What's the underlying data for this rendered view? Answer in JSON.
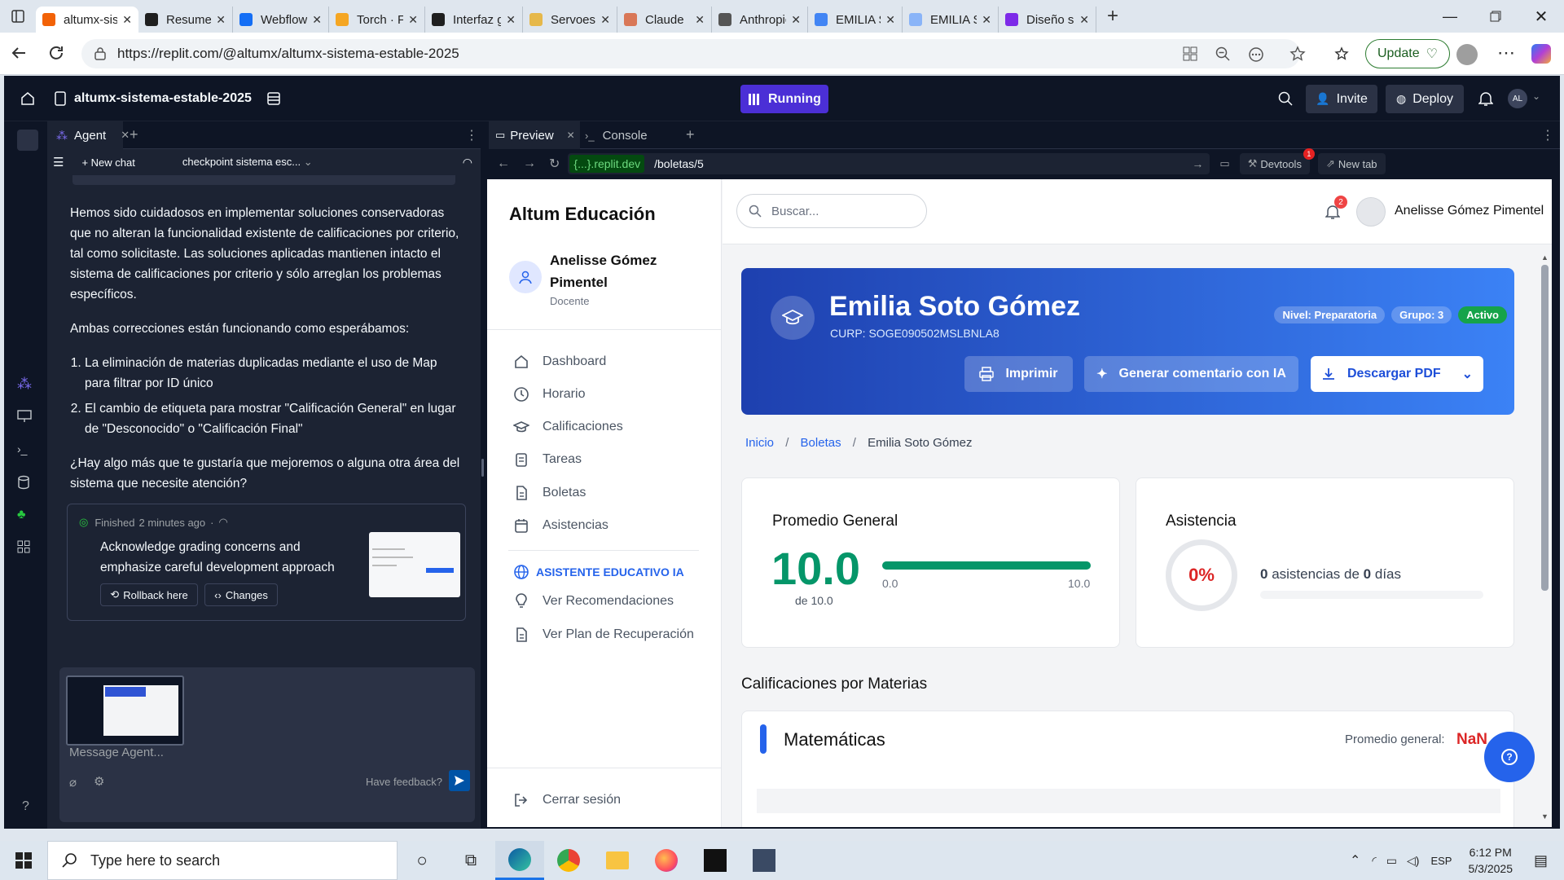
{
  "browser": {
    "tabs": [
      {
        "label": "altumx-sis",
        "color": "#f26207",
        "active": true
      },
      {
        "label": "Resumen",
        "color": "#1f1f1f"
      },
      {
        "label": "Webflow -",
        "color": "#146ef5"
      },
      {
        "label": "Torch · Fea",
        "color": "#f5a623"
      },
      {
        "label": "Interfaz ge",
        "color": "#1f1f1f"
      },
      {
        "label": "Servoesco",
        "color": "#e6b84a"
      },
      {
        "label": "Claude",
        "color": "#d97757"
      },
      {
        "label": "Anthropic",
        "color": "#555555"
      },
      {
        "label": "EMILIA SC",
        "color": "#4285f4"
      },
      {
        "label": "EMILIA SC",
        "color": "#8ab4f8"
      },
      {
        "label": "Diseño sin",
        "color": "#7d2ae8"
      }
    ],
    "url": "https://replit.com/@altumx/altumx-sistema-estable-2025",
    "update_label": "Update"
  },
  "replit": {
    "project_name": "altumx-sistema-estable-2025",
    "status": "Running",
    "invite_label": "Invite",
    "deploy_label": "Deploy",
    "avatar_initials": "AL",
    "agent_tab": "Agent",
    "new_chat": "New chat",
    "checkpoint": "checkpoint sistema esc...",
    "paragraph1": "Hemos sido cuidadosos en implementar soluciones conservadoras que no alteran la funcionalidad existente de calificaciones por criterio, tal como solicitaste. Las soluciones aplicadas mantienen intacto el sistema de calificaciones por criterio y sólo arreglan los problemas específicos.",
    "paragraph2": "Ambas correcciones están funcionando como esperábamos:",
    "list_item1": "La eliminación de materias duplicadas mediante el uso de Map para filtrar por ID único",
    "list_item2": "El cambio de etiqueta para mostrar \"Calificación General\" en lugar de \"Desconocido\" o \"Calificación Final\"",
    "paragraph3": "¿Hay algo más que te gustaría que mejoremos o alguna otra área del sistema que necesite atención?",
    "finished_prefix": "Finished",
    "finished_time": "2 minutes ago",
    "checkpoint_title": "Acknowledge grading concerns and emphasize careful development approach",
    "rollback_label": "Rollback here",
    "changes_label": "Changes",
    "message_placeholder": "Message Agent...",
    "feedback_label": "Have feedback?",
    "preview_tab": "Preview",
    "console_tab": "Console",
    "preview_domain": "{...}.replit.dev",
    "preview_path": "/boletas/5",
    "devtools_label": "Devtools",
    "devtools_badge": "1",
    "newtab_label": "New tab",
    "help_glyph": "?"
  },
  "app": {
    "brand": "Altum Educación",
    "user_name": "Anelisse Gómez Pimentel",
    "user_role": "Docente",
    "nav": [
      "Dashboard",
      "Horario",
      "Calificaciones",
      "Tareas",
      "Boletas",
      "Asistencias"
    ],
    "ai_section": "ASISTENTE EDUCATIVO IA",
    "ai_nav": [
      "Ver Recomendaciones",
      "Ver Plan de Recuperación"
    ],
    "logout": "Cerrar sesión",
    "search_placeholder": "Buscar...",
    "notif_count": "2",
    "header_user": "Anelisse Gómez Pimentel",
    "student": {
      "name": "Emilia Soto Gómez",
      "curp": "CURP: SOGE090502MSLBNLA8",
      "badge_level": "Nivel: Preparatoria",
      "badge_group": "Grupo: 3",
      "badge_status": "Activo"
    },
    "buttons": {
      "print": "Imprimir",
      "ai_comment": "Generar comentario con IA",
      "pdf": "Descargar PDF"
    },
    "breadcrumb": [
      "Inicio",
      "Boletas",
      "Emilia Soto Gómez"
    ],
    "average": {
      "title": "Promedio General",
      "value": "10.0",
      "of": "de 10.0",
      "min": "0.0",
      "max": "10.0",
      "fraction": 1.0
    },
    "attendance": {
      "title": "Asistencia",
      "percent": "0%",
      "count": "0",
      "label_mid": "asistencias de",
      "days": "0",
      "label_end": "días",
      "fraction": 0
    },
    "grades_title": "Calificaciones por Materias",
    "subject": {
      "name": "Matemáticas",
      "avg_label": "Promedio general:",
      "avg_value": "NaN"
    }
  },
  "taskbar": {
    "search_placeholder": "Type here to search",
    "lang": "ESP",
    "time": "6:12 PM",
    "date": "5/3/2025"
  },
  "colors": {
    "accent_blue": "#1d4ed8",
    "green": "#059669",
    "replit_bg": "#0e1525",
    "danger": "#dc2626"
  }
}
